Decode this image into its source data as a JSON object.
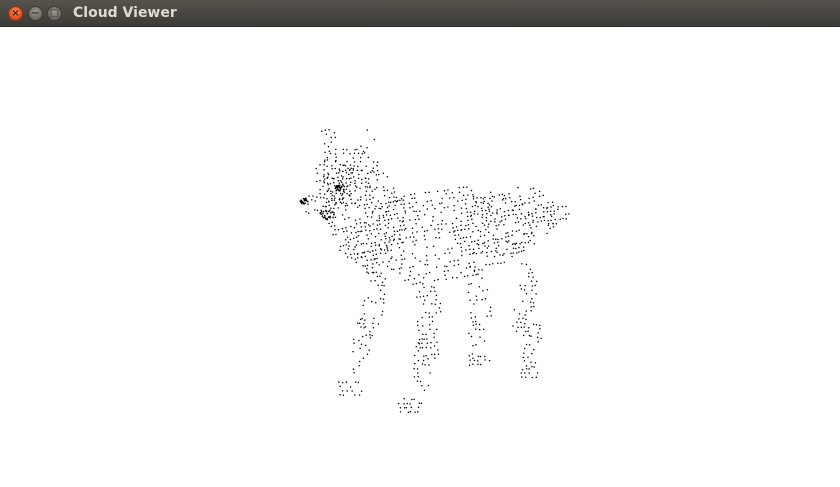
{
  "window": {
    "title": "Cloud Viewer",
    "controls": {
      "close_glyph": "×",
      "minimize_glyph": "−",
      "maximize_glyph": "□"
    }
  },
  "viewport": {
    "background": "#ffffff",
    "point_color": "#000000",
    "content": "wolf-point-cloud"
  }
}
